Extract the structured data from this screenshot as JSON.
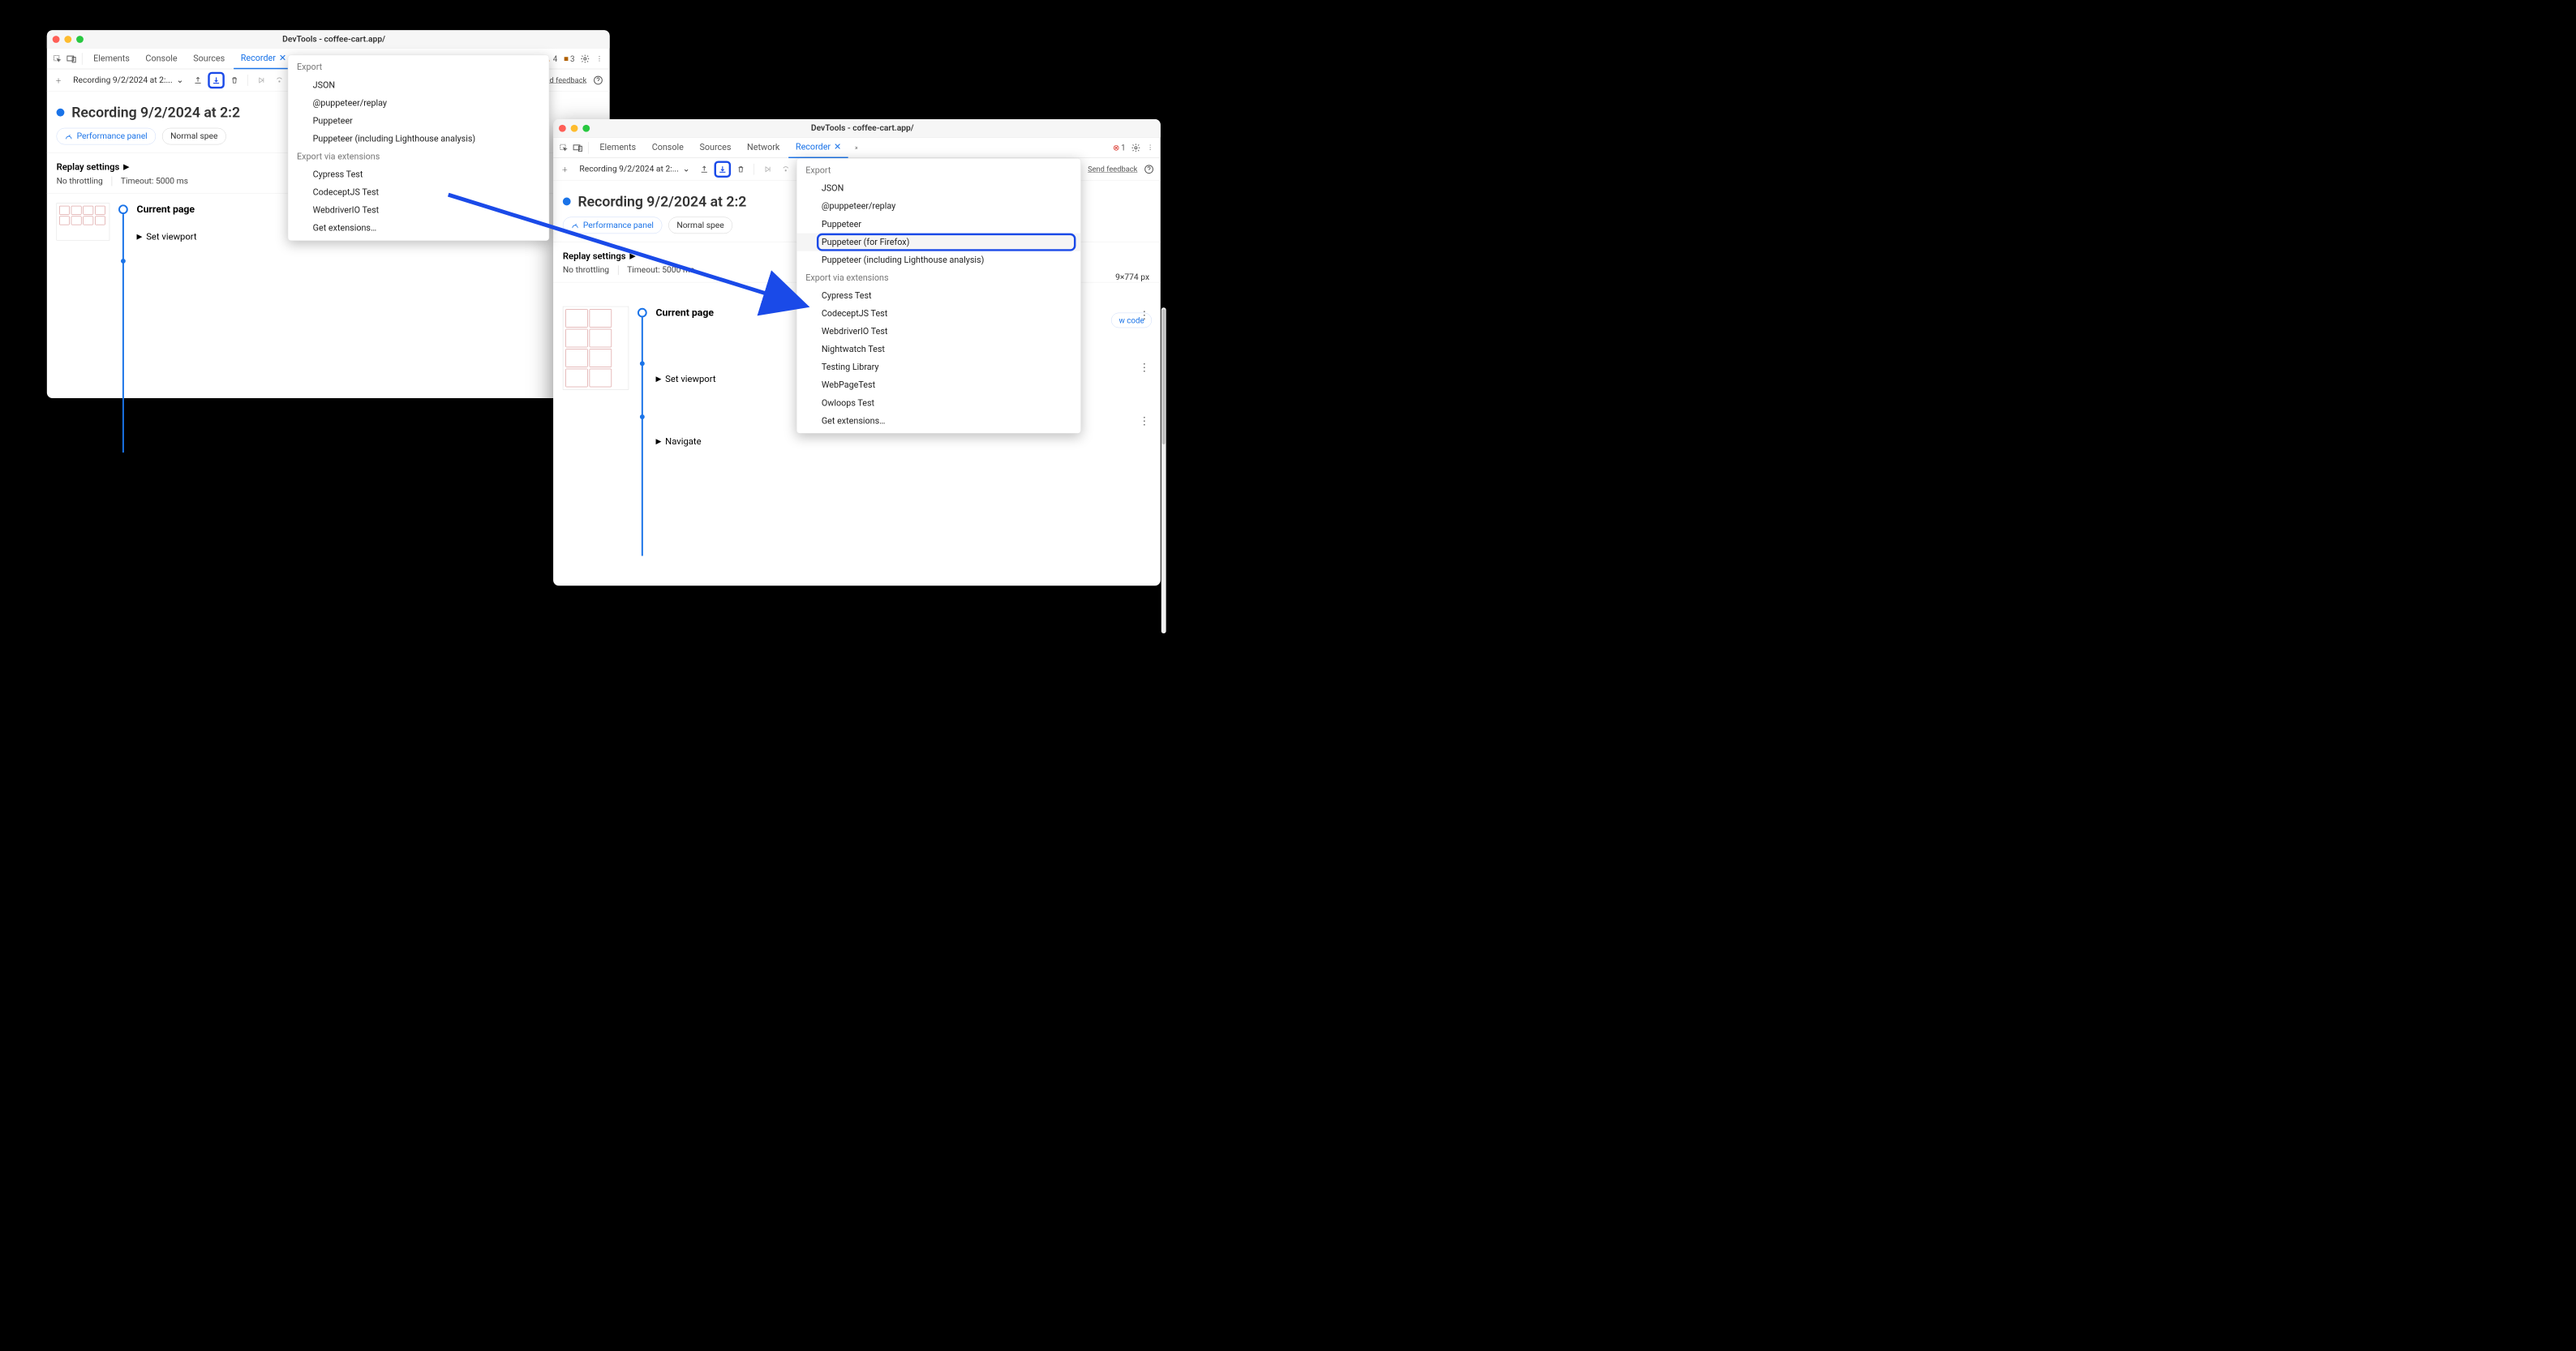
{
  "window_title": "DevTools - coffee-cart.app/",
  "tabs": {
    "elements": "Elements",
    "console": "Console",
    "sources": "Sources",
    "network": "Network",
    "recorder": "Recorder"
  },
  "counters": {
    "errors": "1",
    "warnings": "4",
    "issues": "3",
    "errors2": "1"
  },
  "toolbar": {
    "recording_name": "Recording 9/2/2024 at 2:...",
    "recording_name2": "Recording 9/2/2024 at 2:...",
    "feedback": "Send feedback"
  },
  "heading": "Recording 9/2/2024 at 2:2",
  "heading2": "Recording 9/2/2024 at 2:2",
  "perf_btn": "Performance panel",
  "speed": "Normal spee",
  "speed2": "Normal spee",
  "replay": {
    "title": "Replay settings",
    "no_throttling": "No throttling",
    "timeout": "Timeout: 5000 ms"
  },
  "steps": {
    "current": "Current page",
    "viewport": "Set viewport",
    "navigate": "Navigate",
    "dim": "9×774 px",
    "show_code": "w code"
  },
  "dd1": {
    "head_export": "Export",
    "items_export": [
      "JSON",
      "@puppeteer/replay",
      "Puppeteer",
      "Puppeteer (including Lighthouse analysis)"
    ],
    "head_ext": "Export via extensions",
    "items_ext": [
      "Cypress Test",
      "CodeceptJS Test",
      "WebdriverIO Test",
      "Get extensions…"
    ]
  },
  "dd2": {
    "head_export": "Export",
    "items_export": [
      "JSON",
      "@puppeteer/replay",
      "Puppeteer",
      "Puppeteer (for Firefox)",
      "Puppeteer (including Lighthouse analysis)"
    ],
    "head_ext": "Export via extensions",
    "items_ext": [
      "Cypress Test",
      "CodeceptJS Test",
      "WebdriverIO Test",
      "Nightwatch Test",
      "Testing Library",
      "WebPageTest",
      "Owloops Test",
      "Get extensions…"
    ]
  }
}
